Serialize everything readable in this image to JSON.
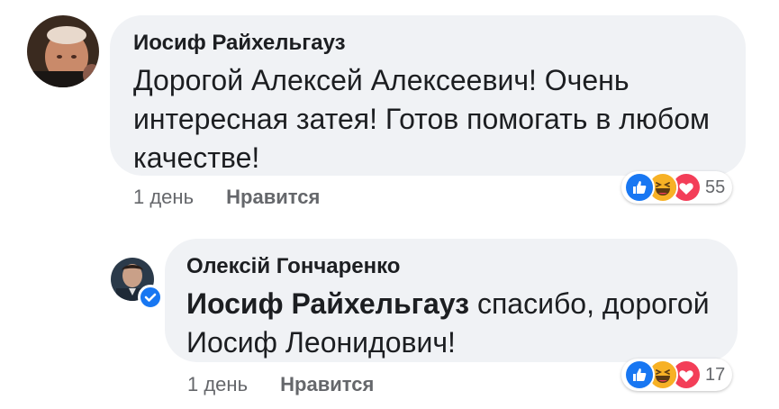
{
  "comments": [
    {
      "author": "Иосиф Райхельгауз",
      "text": "Дорогой Алексей Алексеевич! Очень интересная затея! Готов помогать в любом качестве!",
      "time": "1 день",
      "like_label": "Нравится",
      "reaction_count": "55",
      "reactions": [
        "like-icon",
        "haha-icon",
        "love-icon"
      ]
    },
    {
      "author": "Олексій Гончаренко",
      "mention": "Иосиф Райхельгауз",
      "text": " спасибо, дорогой Иосиф Леонидович!",
      "time": "1 день",
      "like_label": "Нравится",
      "reaction_count": "17",
      "reactions": [
        "like-icon",
        "haha-icon",
        "love-icon"
      ],
      "verified": true
    }
  ],
  "colors": {
    "bubble": "#f0f2f5",
    "meta_text": "#65676b",
    "like_blue": "#1877f2",
    "love_red": "#f33e58",
    "haha_yellow": "#f7b125"
  }
}
